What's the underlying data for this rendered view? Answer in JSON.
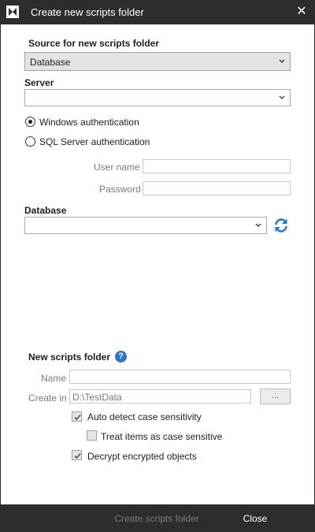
{
  "window": {
    "title": "Create new scripts folder",
    "close_glyph": "✕"
  },
  "source": {
    "heading": "Source for new scripts folder",
    "selected": "Database"
  },
  "server": {
    "heading": "Server",
    "value": ""
  },
  "auth": {
    "windows_label": "Windows authentication",
    "sql_label": "SQL Server authentication",
    "selected": "windows",
    "username_label": "User name",
    "username_value": "",
    "password_label": "Password",
    "password_value": ""
  },
  "database": {
    "heading": "Database",
    "value": ""
  },
  "new_folder": {
    "heading": "New scripts folder",
    "name_label": "Name",
    "name_value": "",
    "create_in_label": "Create in",
    "create_in_value": "D:\\TestData",
    "browse_label": "...",
    "auto_detect_label": "Auto detect case sensitivity",
    "auto_detect_checked": true,
    "treat_case_label": "Treat items as case sensitive",
    "treat_case_checked": false,
    "decrypt_label": "Decrypt encrypted objects",
    "decrypt_checked": true
  },
  "footer": {
    "create_label": "Create scripts folder",
    "close_label": "Close"
  },
  "colors": {
    "titlebar": "#2d2d2d",
    "accent_blue": "#2b74c9",
    "disabled_text": "#7a7a7a"
  }
}
